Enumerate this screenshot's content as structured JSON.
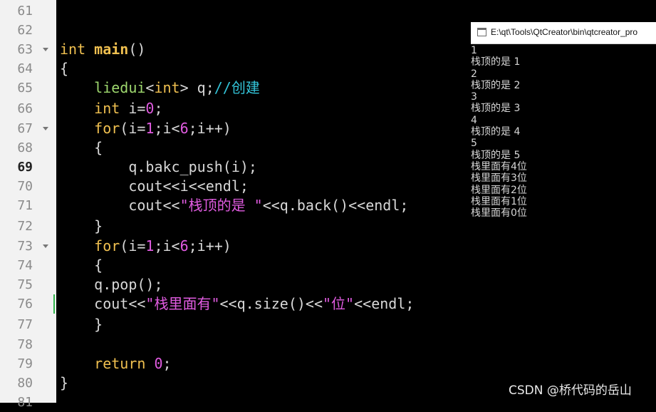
{
  "line_numbers": [
    "61",
    "62",
    "63",
    "64",
    "65",
    "66",
    "67",
    "68",
    "69",
    "70",
    "71",
    "72",
    "73",
    "74",
    "75",
    "76",
    "77",
    "78",
    "79",
    "80",
    "81"
  ],
  "code": {
    "l63": {
      "kw": "int",
      "fn": "main",
      "rest": "()"
    },
    "l64": {
      "text": "{"
    },
    "l65": {
      "ident": "liedui",
      "lt": "<",
      "tplarg": "int",
      "gt": ">",
      "var": " q;",
      "comment": "//创建"
    },
    "l66": {
      "kw": "int",
      "mid": " i=",
      "num": "0",
      "end": ";"
    },
    "l67": {
      "kw": "for",
      "a": "(i=",
      "n1": "1",
      "b": ";i<",
      "n2": "6",
      "c": ";i++)"
    },
    "l68": {
      "text": "{"
    },
    "l69": {
      "text": "q.bakc_push(i);"
    },
    "l70": {
      "text": "cout<<i<<endl;"
    },
    "l71": {
      "a": "cout<<",
      "str": "\"栈顶的是 \"",
      "b": "<<q.back()<<endl;"
    },
    "l72": {
      "text": "}"
    },
    "l73": {
      "kw": "for",
      "a": "(i=",
      "n1": "1",
      "b": ";i<",
      "n2": "6",
      "c": ";i++)"
    },
    "l74": {
      "text": "{"
    },
    "l75": {
      "text": "q.pop();"
    },
    "l76": {
      "a": "cout<<",
      "str1": "\"栈里面有\"",
      "b": "<<q.size()<<",
      "str2": "\"位\"",
      "c": "<<endl;"
    },
    "l77": {
      "text": "}"
    },
    "l79": {
      "kw": "return",
      "sp": " ",
      "num": "0",
      "end": ";"
    },
    "l80": {
      "text": "}"
    }
  },
  "console": {
    "title": "E:\\qt\\Tools\\QtCreator\\bin\\qtcreator_pro",
    "output": [
      "1",
      "栈顶的是 1",
      "2",
      "栈顶的是 2",
      "3",
      "栈顶的是 3",
      "4",
      "栈顶的是 4",
      "5",
      "栈顶的是 5",
      "栈里面有4位",
      "栈里面有3位",
      "栈里面有2位",
      "栈里面有1位",
      "栈里面有0位"
    ]
  },
  "watermark": "CSDN @桥代码的岳山"
}
